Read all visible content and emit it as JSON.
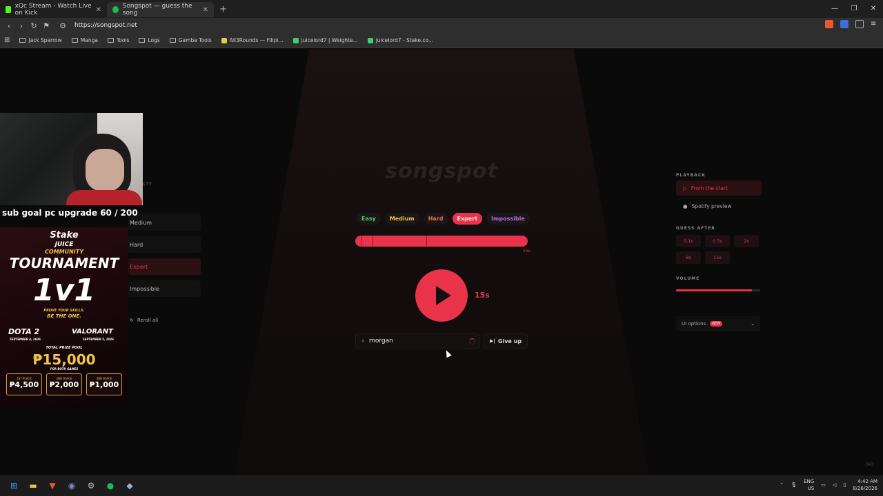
{
  "browser": {
    "tabs": [
      {
        "title": "xQc Stream - Watch Live on Kick",
        "active": false
      },
      {
        "title": "Songspot — guess the song",
        "active": true
      }
    ],
    "url": "https://songspot.net",
    "bookmarks": [
      "Jack Sparrow",
      "Manga",
      "Tools",
      "Logs",
      "Gamba Tools",
      "All3Rounds — Filipi...",
      "juicelord7 | Weighte...",
      "juicelord7 - Stake.co..."
    ]
  },
  "game": {
    "logo": "songspot",
    "difficulties": [
      {
        "label": "Easy",
        "color": "#3ecf6e",
        "selected": false
      },
      {
        "label": "Medium",
        "color": "#e6c84a",
        "selected": false
      },
      {
        "label": "Hard",
        "color": "#e8734a",
        "selected": false
      },
      {
        "label": "Expert",
        "color": "#ffffff",
        "selected": true
      },
      {
        "label": "Impossible",
        "color": "#b26be8",
        "selected": false
      }
    ],
    "progress_label": "15s",
    "timer": "15s",
    "search_value": "morgan",
    "give_up": "Give up"
  },
  "left_panel": {
    "heading": "LTY",
    "items": [
      {
        "label": "Medium",
        "selected": false
      },
      {
        "label": "Hard",
        "selected": false
      },
      {
        "label": "Expert",
        "selected": true
      },
      {
        "label": "Impossible",
        "selected": false
      }
    ],
    "reroll": "Reroll all"
  },
  "right_panel": {
    "playback_heading": "PLAYBACK",
    "playback_options": [
      {
        "label": "From the start",
        "selected": true
      },
      {
        "label": "Spotify preview",
        "selected": false
      }
    ],
    "guess_after_heading": "GUESS AFTER",
    "guess_after": [
      "0.1s",
      "0.5s",
      "2s",
      "8s",
      "15s"
    ],
    "volume_heading": "VOLUME",
    "volume_level": 0.9,
    "ui_options": "UI options",
    "new_badge": "NEW"
  },
  "faq": "FAQ",
  "overlay": {
    "sub_goal": "sub goal pc upgrade 60 / 200",
    "ad": {
      "brand": "Stake",
      "line1": "JUICE",
      "line2": "COMMUNITY",
      "line3": "TOURNAMENT",
      "format": "1v1",
      "tagline1": "PROVE YOUR SKILLS.",
      "tagline2": "BE THE ONE.",
      "game1": "DOTA 2",
      "game1_date": "SEPTEMBER 4, 2026",
      "game2": "VALORANT",
      "game2_date": "SEPTEMBER 5, 2026",
      "pool_label": "TOTAL PRIZE POOL",
      "pool": "₱15,000",
      "pool_note": "FOR BOTH GAMES",
      "prizes": [
        {
          "place": "1ST PLACE",
          "amount": "₱4,500"
        },
        {
          "place": "2ND PLACE",
          "amount": "₱2,000"
        },
        {
          "place": "3RD PLACE",
          "amount": "₱1,000"
        }
      ]
    }
  },
  "taskbar": {
    "lang": "ENG",
    "region": "US",
    "time": "4:42 AM",
    "date": "8/26/2026"
  }
}
